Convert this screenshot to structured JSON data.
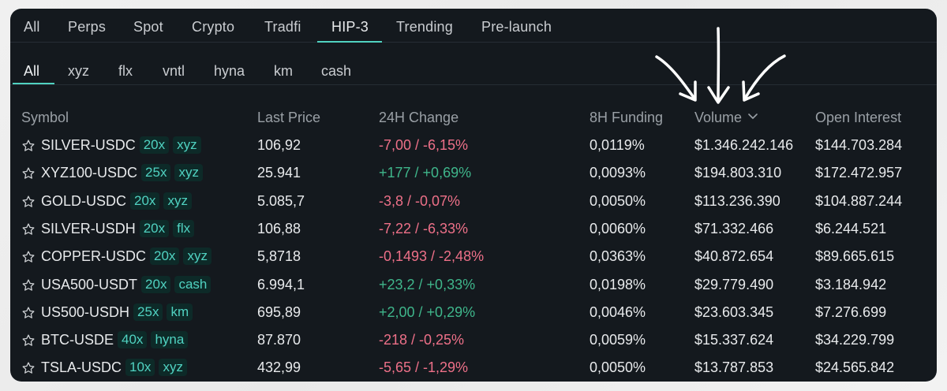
{
  "top_tabs": [
    "All",
    "Perps",
    "Spot",
    "Crypto",
    "Tradfi",
    "HIP-3",
    "Trending",
    "Pre-launch"
  ],
  "sub_tabs": [
    "All",
    "xyz",
    "flx",
    "vntl",
    "hyna",
    "km",
    "cash"
  ],
  "active_top_tab": "HIP-3",
  "active_sub_tab": "All",
  "columns": {
    "symbol": "Symbol",
    "last_price": "Last Price",
    "change": "24H Change",
    "funding": "8H Funding",
    "volume": "Volume",
    "open_interest": "Open Interest"
  },
  "rows": [
    {
      "symbol": "SILVER-USDC",
      "leverage": "20x",
      "dex": "xyz",
      "last_price": "106,92",
      "change": "-7,00 / -6,15%",
      "direction": "down",
      "funding": "0,0119%",
      "volume": "$1.346.242.146",
      "open_interest": "$144.703.284"
    },
    {
      "symbol": "XYZ100-USDC",
      "leverage": "25x",
      "dex": "xyz",
      "last_price": "25.941",
      "change": "+177 / +0,69%",
      "direction": "up",
      "funding": "0,0093%",
      "volume": "$194.803.310",
      "open_interest": "$172.472.957"
    },
    {
      "symbol": "GOLD-USDC",
      "leverage": "20x",
      "dex": "xyz",
      "last_price": "5.085,7",
      "change": "-3,8 / -0,07%",
      "direction": "down",
      "funding": "0,0050%",
      "volume": "$113.236.390",
      "open_interest": "$104.887.244"
    },
    {
      "symbol": "SILVER-USDH",
      "leverage": "20x",
      "dex": "flx",
      "last_price": "106,88",
      "change": "-7,22 / -6,33%",
      "direction": "down",
      "funding": "0,0060%",
      "volume": "$71.332.466",
      "open_interest": "$6.244.521"
    },
    {
      "symbol": "COPPER-USDC",
      "leverage": "20x",
      "dex": "xyz",
      "last_price": "5,8718",
      "change": "-0,1493 / -2,48%",
      "direction": "down",
      "funding": "0,0363%",
      "volume": "$40.872.654",
      "open_interest": "$89.665.615"
    },
    {
      "symbol": "USA500-USDT",
      "leverage": "20x",
      "dex": "cash",
      "last_price": "6.994,1",
      "change": "+23,2 / +0,33%",
      "direction": "up",
      "funding": "0,0198%",
      "volume": "$29.779.490",
      "open_interest": "$3.184.942"
    },
    {
      "symbol": "US500-USDH",
      "leverage": "25x",
      "dex": "km",
      "last_price": "695,89",
      "change": "+2,00 / +0,29%",
      "direction": "up",
      "funding": "0,0046%",
      "volume": "$23.603.345",
      "open_interest": "$7.276.699"
    },
    {
      "symbol": "BTC-USDE",
      "leverage": "40x",
      "dex": "hyna",
      "last_price": "87.870",
      "change": "-218 / -0,25%",
      "direction": "down",
      "funding": "0,0059%",
      "volume": "$15.337.624",
      "open_interest": "$34.229.799"
    },
    {
      "symbol": "TSLA-USDC",
      "leverage": "10x",
      "dex": "xyz",
      "last_price": "432,99",
      "change": "-5,65 / -1,29%",
      "direction": "down",
      "funding": "0,0050%",
      "volume": "$13.787.853",
      "open_interest": "$24.565.842"
    }
  ],
  "colors": {
    "background": "#14191e",
    "accent": "#50d2c1",
    "negative": "#ed7088",
    "positive": "#3fb68b"
  },
  "icons": {
    "star": "star-outline-icon",
    "sort": "chevron-down-icon",
    "annotation": "hand-drawn-arrows-icon"
  }
}
